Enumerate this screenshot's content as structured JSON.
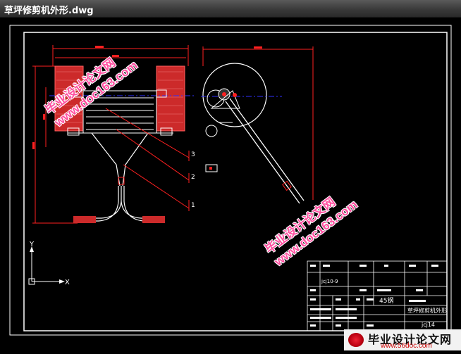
{
  "window": {
    "title": "草坪修剪机外形.dwg"
  },
  "colors": {
    "accent_red": "#ff2020",
    "line_white": "#ffffff",
    "center_blue": "#3030ff",
    "watermark_pink": "#ff4fa0"
  },
  "drawing": {
    "balloons": [
      "3",
      "2",
      "1"
    ],
    "ucs": {
      "x_label": "X",
      "y_label": "Y"
    }
  },
  "title_block": {
    "material": "45钢",
    "drawing_name": "草坪修剪机外形",
    "code_top": "jcj10-9",
    "code_bottom": "jcj14"
  },
  "watermarks": {
    "site_name": "毕业设计论文网",
    "url": "www.doc163.com"
  },
  "badge": {
    "name": "毕业设计论文网",
    "url": "www.56doc.com"
  }
}
